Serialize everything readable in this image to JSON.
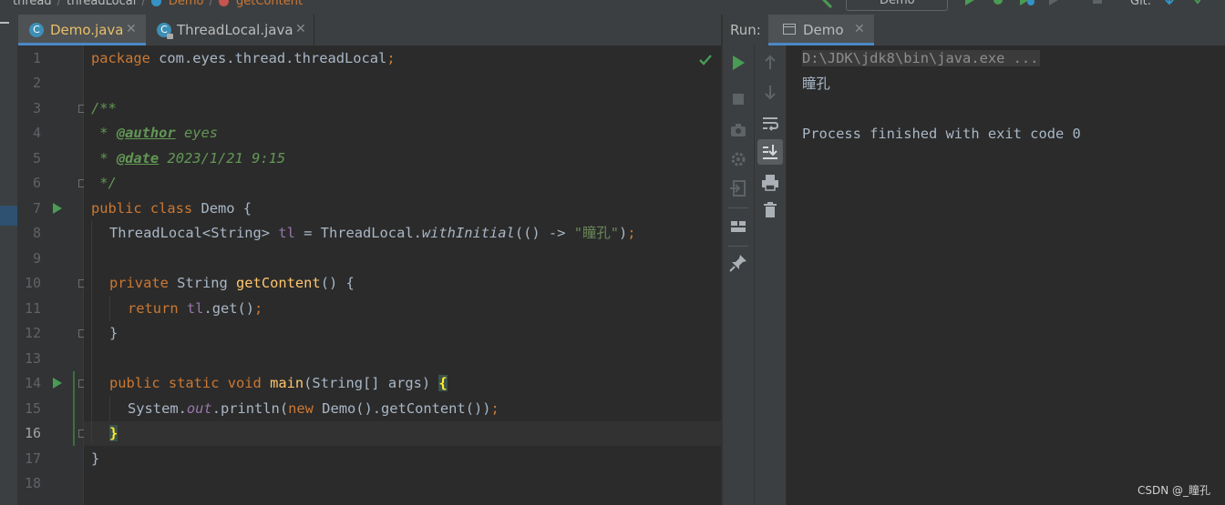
{
  "breadcrumbs": {
    "module": "thread",
    "package": "threadLocal",
    "class": "Demo",
    "method": "getContent"
  },
  "toolbar": {
    "run_config": "Demo",
    "git_label": "Git:"
  },
  "editor": {
    "tabs": [
      {
        "label": "Demo.java",
        "active": true
      },
      {
        "label": "ThreadLocal.java",
        "active": false
      }
    ],
    "line_numbers": [
      "1",
      "2",
      "3",
      "4",
      "5",
      "6",
      "7",
      "8",
      "9",
      "10",
      "11",
      "12",
      "13",
      "14",
      "15",
      "16",
      "17",
      "18"
    ],
    "current_line": "16",
    "code": {
      "l1_kw": "package",
      "l1_pkg": " com.eyes.thread.threadLocal",
      "l1_semi": ";",
      "l3": "/**",
      "l4_star": " * ",
      "l4_tag": "@author",
      "l4_val": " eyes",
      "l5_star": " * ",
      "l5_tag": "@date",
      "l5_val": " 2023/1/21 9:15",
      "l6": " */",
      "l7_kw": "public class",
      "l7_rest": " Demo {",
      "l8_type": "ThreadLocal<String> ",
      "l8_field": "tl",
      "l8_eq": " = ThreadLocal.",
      "l8_method": "withInitial",
      "l8_lambda": "(() -> ",
      "l8_str": "\"瞳孔\"",
      "l8_end": ")",
      "l8_semi": ";",
      "l10_kw": "private",
      "l10_type": " String ",
      "l10_fn": "getContent",
      "l10_rest": "() {",
      "l11_kw": "return",
      "l11_sp": " ",
      "l11_field": "tl",
      "l11_rest": ".get()",
      "l11_semi": ";",
      "l12": "}",
      "l14_kw": "public static void",
      "l14_sp": " ",
      "l14_fn": "main",
      "l14_rest": "(String[] args) ",
      "l14_brace": "{",
      "l15_a": "System.",
      "l15_out": "out",
      "l15_b": ".println(",
      "l15_new": "new",
      "l15_c": " Demo().getContent())",
      "l15_semi": ";",
      "l16_brace": "}",
      "l17": "}"
    }
  },
  "run_panel": {
    "label": "Run:",
    "tab": "Demo",
    "console": {
      "command": "D:\\JDK\\jdk8\\bin\\java.exe ...",
      "output": "瞳孔",
      "finished": "Process finished with exit code 0"
    }
  },
  "watermark": "CSDN @_瞳孔"
}
